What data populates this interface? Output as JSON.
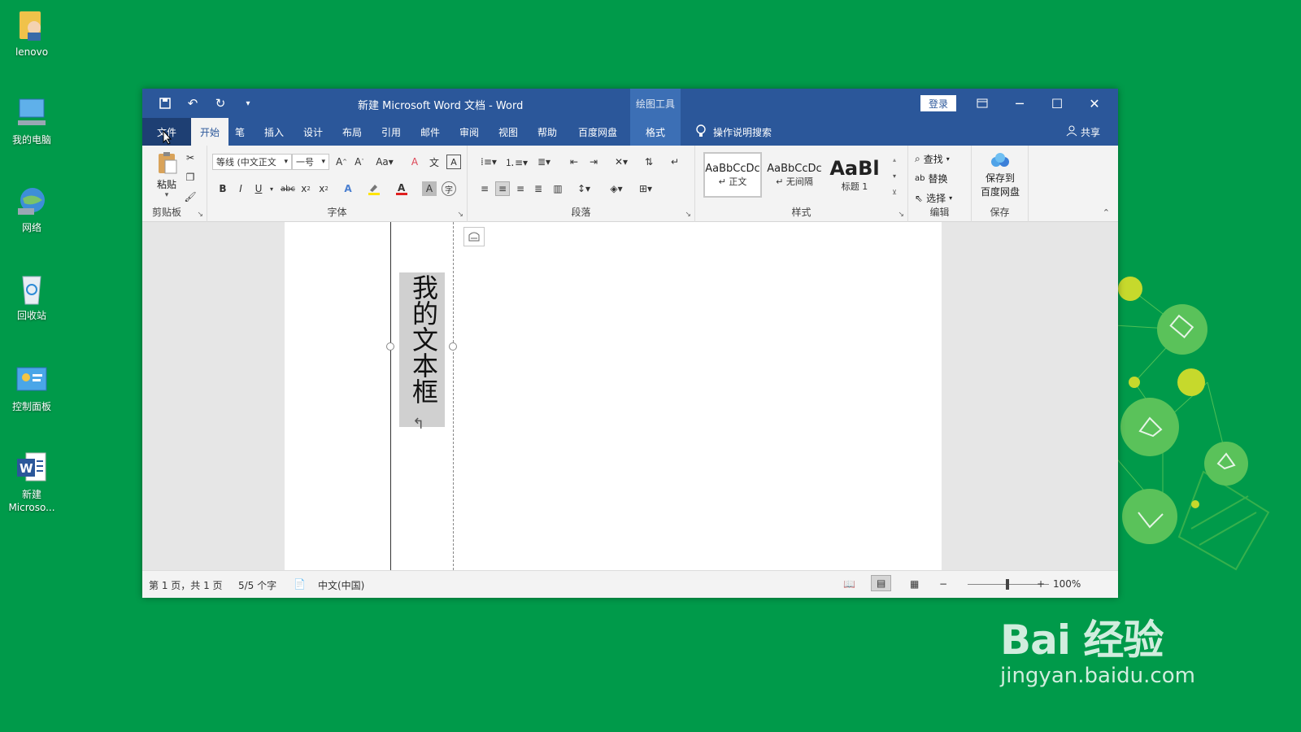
{
  "desktop": {
    "icons": [
      {
        "label": "lenovo",
        "icon": "user-folder-icon"
      },
      {
        "label": "我的电脑",
        "icon": "computer-icon"
      },
      {
        "label": "网络",
        "icon": "network-globe-icon"
      },
      {
        "label": "回收站",
        "icon": "recycle-bin-icon"
      },
      {
        "label": "控制面板",
        "icon": "control-panel-icon"
      },
      {
        "label_line1": "新建",
        "label_line2": "Microso...",
        "icon": "word-document-icon"
      }
    ]
  },
  "watermark": {
    "big": "Bai 经验",
    "small": "jingyan.baidu.com"
  },
  "window": {
    "title": "新建 Microsoft Word 文档  -  Word",
    "context_title": "绘图工具",
    "login": "登录",
    "tabs": [
      "文件",
      "开始",
      "笔",
      "插入",
      "设计",
      "布局",
      "引用",
      "邮件",
      "审阅",
      "视图",
      "帮助",
      "百度网盘",
      "格式"
    ],
    "tell_me": "操作说明搜索",
    "share": "共享"
  },
  "ribbon": {
    "clipboard": {
      "label": "剪贴板",
      "paste": "粘贴"
    },
    "font": {
      "label": "字体",
      "font_name": "等线 (中文正文",
      "font_size": "一号",
      "aa": "Aa"
    },
    "paragraph": {
      "label": "段落"
    },
    "styles": {
      "label": "样式",
      "items": [
        {
          "preview": "AaBbCcDc",
          "name": "↵ 正文"
        },
        {
          "preview": "AaBbCcDc",
          "name": "↵ 无间隔"
        },
        {
          "preview": "AaBl",
          "name": "标题 1"
        }
      ]
    },
    "editing": {
      "label": "编辑",
      "find": "查找",
      "replace": "替换",
      "select": "选择"
    },
    "save": {
      "label": "保存",
      "line1": "保存到",
      "line2": "百度网盘"
    }
  },
  "document": {
    "textbox_text": "我的文本框"
  },
  "status": {
    "page": "第 1 页，共 1 页",
    "words": "5/5 个字",
    "language": "中文(中国)",
    "zoom": "100%"
  },
  "colors": {
    "word_blue": "#2b579a",
    "desktop_green": "#009a4a"
  }
}
